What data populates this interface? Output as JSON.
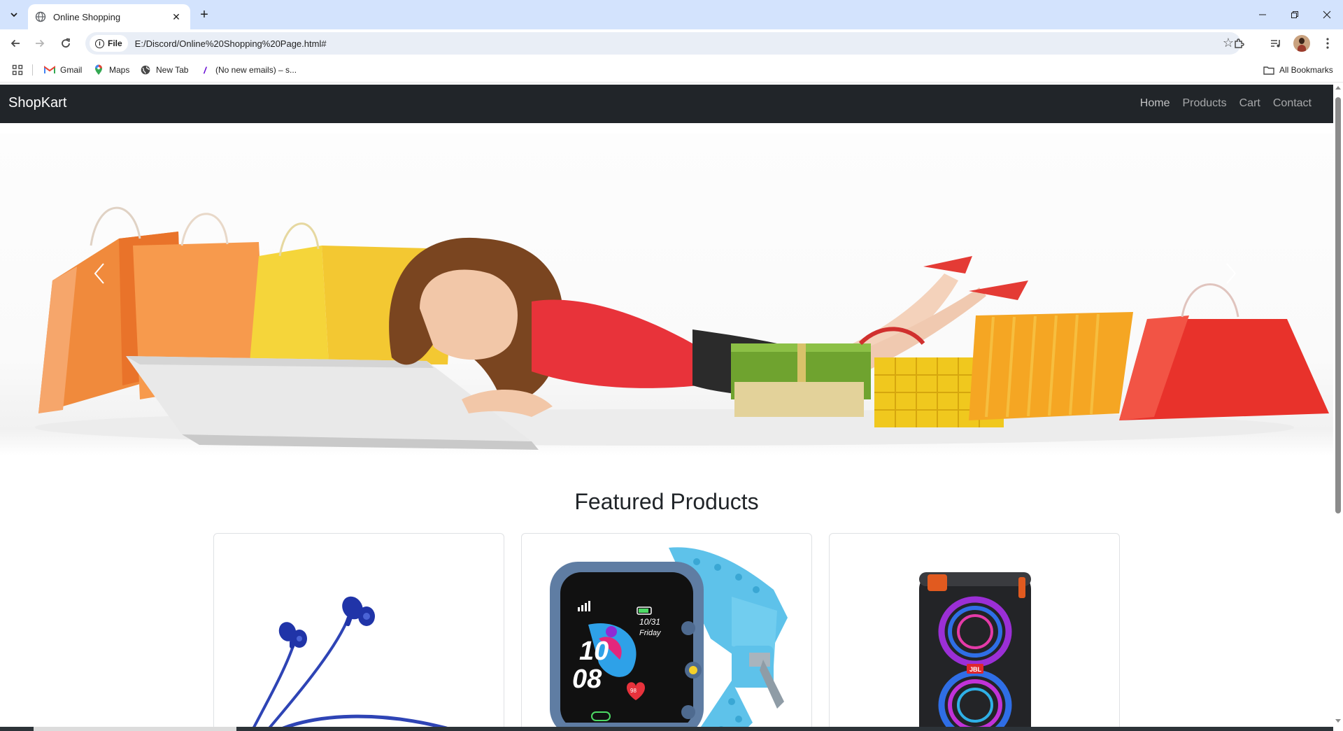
{
  "browser": {
    "tab_title": "Online Shopping",
    "url_chip": "File",
    "url": "E:/Discord/Online%20Shopping%20Page.html#",
    "bookmarks": [
      {
        "label": "Gmail",
        "icon": "gmail-icon"
      },
      {
        "label": "Maps",
        "icon": "maps-pin-icon"
      },
      {
        "label": "New Tab",
        "icon": "globe-icon"
      },
      {
        "label": "(No new emails) – s...",
        "icon": "yahoo-mail-icon"
      }
    ],
    "all_bookmarks": "All Bookmarks"
  },
  "page": {
    "brand": "ShopKart",
    "nav": [
      "Home",
      "Products",
      "Cart",
      "Contact"
    ],
    "featured_title": "Featured Products",
    "cards": [
      {
        "image": "blue-earphones"
      },
      {
        "image": "kids-smartwatch",
        "watch_date": "10/31",
        "watch_day": "Friday",
        "watch_hour": "10",
        "watch_min": "08",
        "watch_badge": "98"
      },
      {
        "image": "jbl-party-speaker",
        "logo": "JBL"
      }
    ]
  },
  "colors": {
    "navbar": "#212529",
    "tabstrip": "#d3e3fd",
    "watch_band": "#5ec2ea"
  }
}
